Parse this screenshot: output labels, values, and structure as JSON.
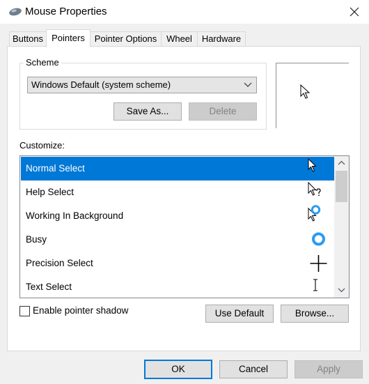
{
  "window": {
    "title": "Mouse Properties",
    "close_icon": "close-icon",
    "app_icon": "mouse-icon"
  },
  "tabs": [
    {
      "label": "Buttons"
    },
    {
      "label": "Pointers",
      "active": true
    },
    {
      "label": "Pointer Options"
    },
    {
      "label": "Wheel"
    },
    {
      "label": "Hardware"
    }
  ],
  "scheme": {
    "group_label": "Scheme",
    "selected": "Windows Default (system scheme)",
    "save_as_label": "Save As...",
    "delete_label": "Delete"
  },
  "customize": {
    "label": "Customize:",
    "items": [
      {
        "label": "Normal Select",
        "icon": "arrow-cursor-icon",
        "selected": true
      },
      {
        "label": "Help Select",
        "icon": "help-cursor-icon"
      },
      {
        "label": "Working In Background",
        "icon": "working-cursor-icon"
      },
      {
        "label": "Busy",
        "icon": "busy-cursor-icon"
      },
      {
        "label": "Precision Select",
        "icon": "crosshair-cursor-icon"
      },
      {
        "label": "Text Select",
        "icon": "ibeam-cursor-icon"
      }
    ]
  },
  "options": {
    "pointer_shadow_label": "Enable pointer shadow",
    "pointer_shadow_checked": false,
    "use_default_label": "Use Default",
    "browse_label": "Browse..."
  },
  "footer": {
    "ok_label": "OK",
    "cancel_label": "Cancel",
    "apply_label": "Apply"
  },
  "colors": {
    "selection": "#0078d7",
    "accent_ring": "#2b9bf0"
  }
}
